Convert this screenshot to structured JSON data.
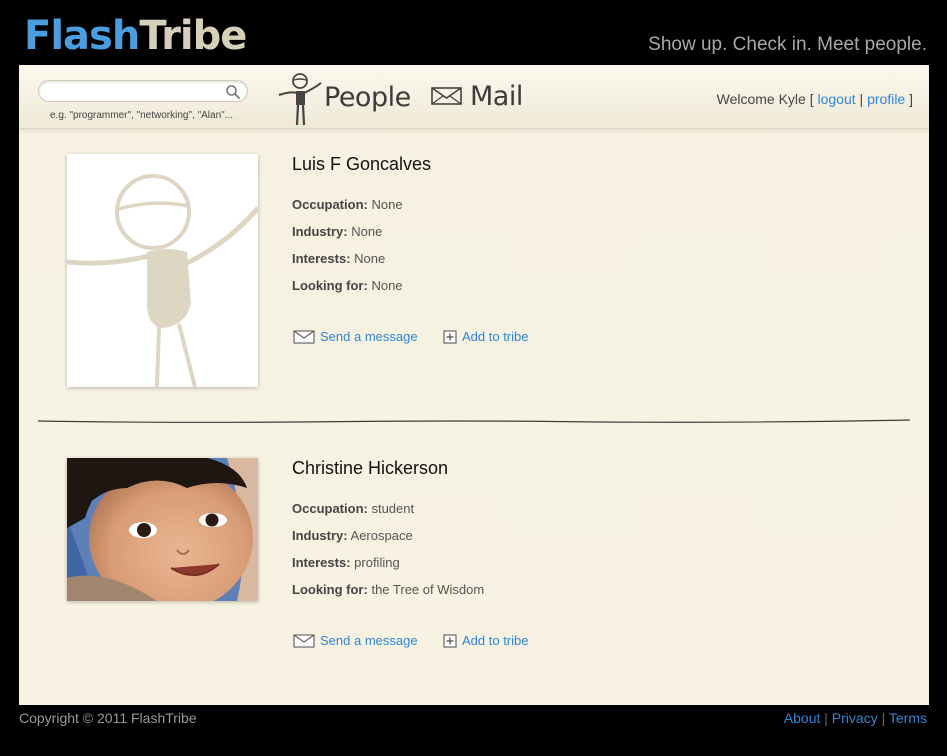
{
  "header": {
    "logo_part1": "Flash",
    "logo_part2": "Tribe",
    "tagline": "Show up. Check in. Meet people."
  },
  "search": {
    "value": "",
    "placeholder": "",
    "hint": "e.g. \"programmer\", \"networking\", \"Alan\"..."
  },
  "nav": {
    "people_label": "People",
    "mail_label": "Mail"
  },
  "welcome": {
    "text": "Welcome Kyle [",
    "logout": "logout",
    "sep": "|",
    "profile": "profile",
    "close": "]"
  },
  "profiles": [
    {
      "name": "Luis F Goncalves",
      "photo_icon": "default-stick-figure-avatar",
      "occupation_label": "Occupation:",
      "occupation": "None",
      "industry_label": "Industry:",
      "industry": "None",
      "interests_label": "Interests:",
      "interests": "None",
      "looking_label": "Looking for:",
      "looking": "None",
      "send_message": "Send a message",
      "add_to_tribe": "Add to tribe"
    },
    {
      "name": "Christine Hickerson",
      "photo_icon": "child-face-photo",
      "occupation_label": "Occupation:",
      "occupation": "student",
      "industry_label": "Industry:",
      "industry": "Aerospace",
      "interests_label": "Interests:",
      "interests": "profiling",
      "looking_label": "Looking for:",
      "looking": "the Tree of Wisdom",
      "send_message": "Send a message",
      "add_to_tribe": "Add to tribe"
    }
  ],
  "footer": {
    "copyright": "Copyright © 2011 FlashTribe",
    "about": "About",
    "privacy": "Privacy",
    "terms": "Terms",
    "sep": "|"
  },
  "colors": {
    "background": "#000000",
    "panel": "#f6f1e1",
    "link": "#2f86d6",
    "logo_blue": "#4a9ee0",
    "logo_tan": "#d6d0ba"
  }
}
